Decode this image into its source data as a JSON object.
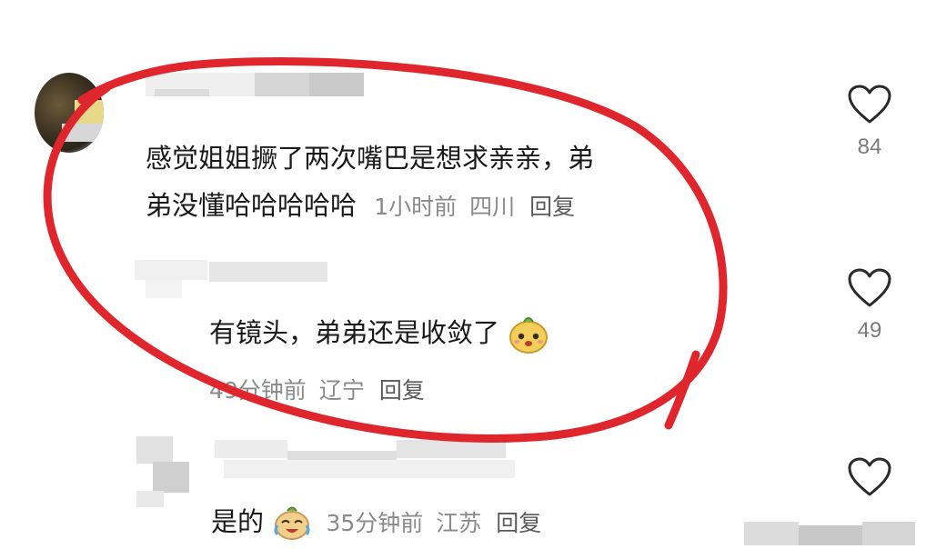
{
  "comments": [
    {
      "text_line1": "感觉姐姐撅了两次嘴巴是想求亲亲，弟",
      "text_line2": "弟没懂哈哈哈哈哈",
      "time": "1小时前",
      "location": "四川",
      "reply_label": "回复",
      "likes": "84"
    },
    {
      "text": "有镜头，弟弟还是收敛了",
      "emoji": "face-emoji",
      "time": "49分钟前",
      "location": "辽宁",
      "reply_label": "回复",
      "likes": "49"
    },
    {
      "text": "是的",
      "emoji": "crying-laughing-emoji",
      "time": "35分钟前",
      "location": "江苏",
      "reply_label": "回复"
    }
  ],
  "icons": {
    "like": "heart-outline-icon"
  },
  "colors": {
    "annotation": "#e0262d",
    "meta": "#8a8a8a"
  }
}
